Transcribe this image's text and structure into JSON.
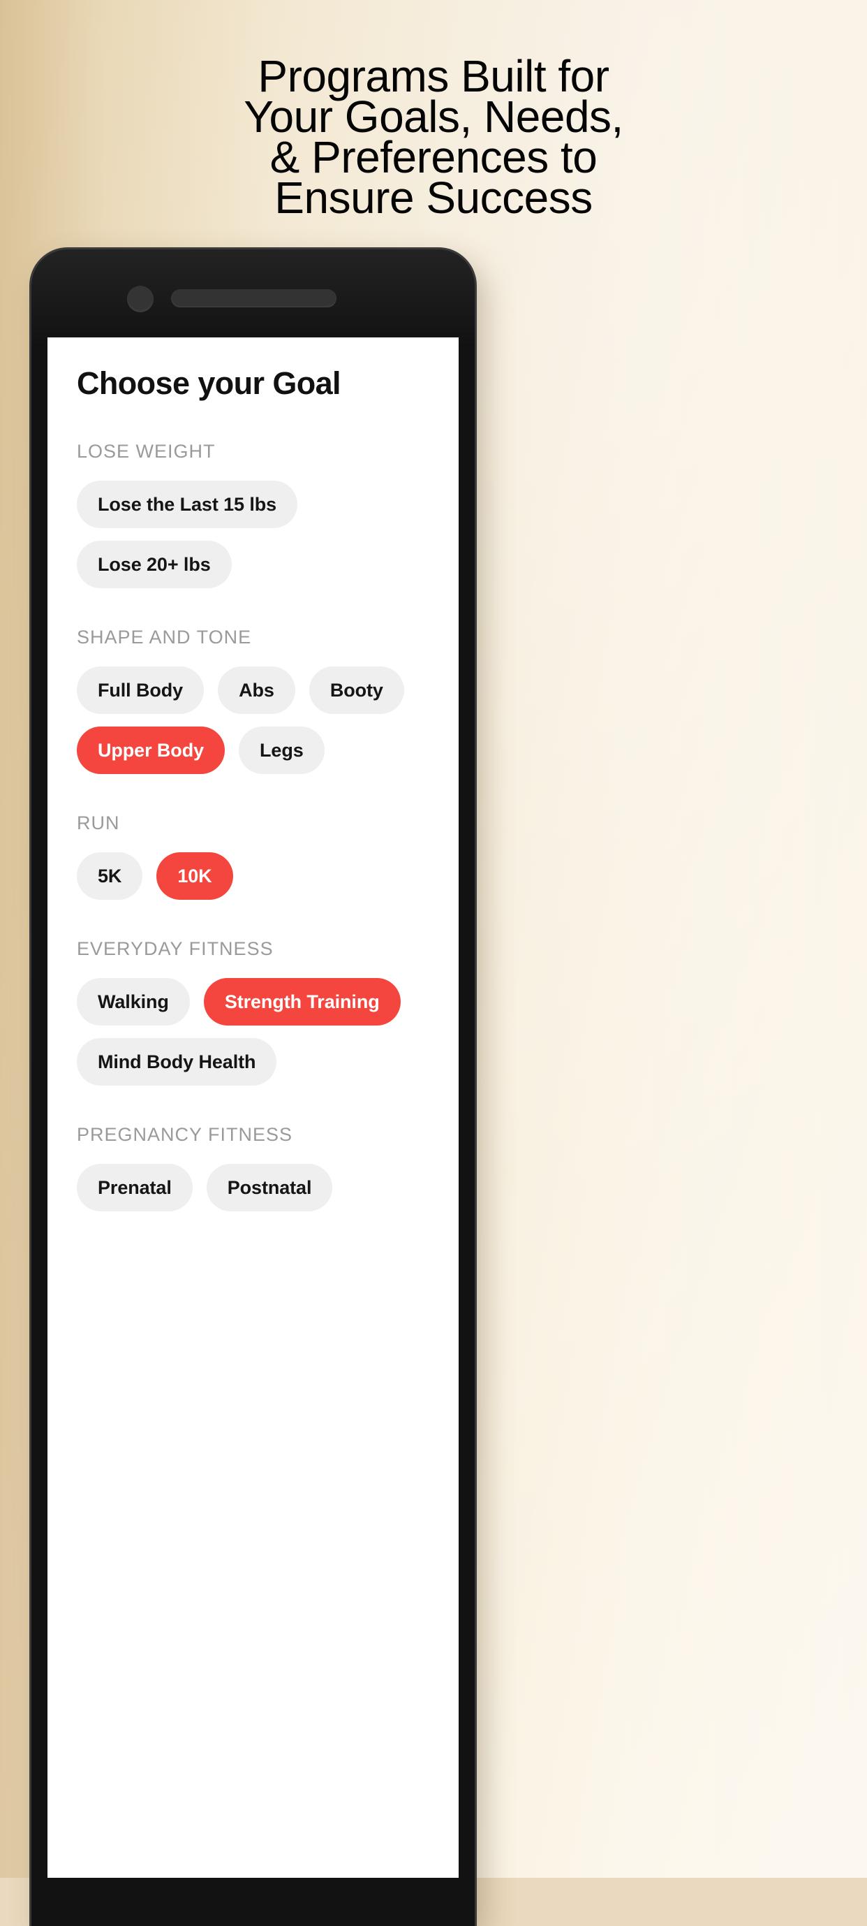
{
  "promo": {
    "headline_lines": [
      "Programs Built for",
      "Your Goals, Needs,",
      "& Preferences to",
      "Ensure Success"
    ]
  },
  "colors": {
    "accent_red": "#F4463E",
    "chip_gray": "#EFEFEF",
    "label_gray": "#9A9A9A",
    "phone_body": "#121212",
    "screen_bg": "#FFFFFF"
  },
  "app": {
    "title": "Choose your Goal",
    "sections": [
      {
        "label": "LOSE WEIGHT",
        "chips": [
          {
            "label": "Lose the Last 15 lbs",
            "selected": false
          },
          {
            "label": "Lose 20+ lbs",
            "selected": false
          }
        ]
      },
      {
        "label": "SHAPE AND TONE",
        "chips": [
          {
            "label": "Full Body",
            "selected": false
          },
          {
            "label": "Abs",
            "selected": false
          },
          {
            "label": "Booty",
            "selected": false
          },
          {
            "label": "Upper Body",
            "selected": true
          },
          {
            "label": "Legs",
            "selected": false
          }
        ]
      },
      {
        "label": "RUN",
        "chips": [
          {
            "label": "5K",
            "selected": false
          },
          {
            "label": "10K",
            "selected": true
          }
        ]
      },
      {
        "label": "EVERYDAY FITNESS",
        "chips": [
          {
            "label": "Walking",
            "selected": false
          },
          {
            "label": "Strength Training",
            "selected": true
          },
          {
            "label": "Mind Body Health",
            "selected": false
          }
        ]
      },
      {
        "label": "PREGNANCY FITNESS",
        "chips": [
          {
            "label": "Prenatal",
            "selected": false
          },
          {
            "label": "Postnatal",
            "selected": false
          }
        ]
      }
    ]
  }
}
